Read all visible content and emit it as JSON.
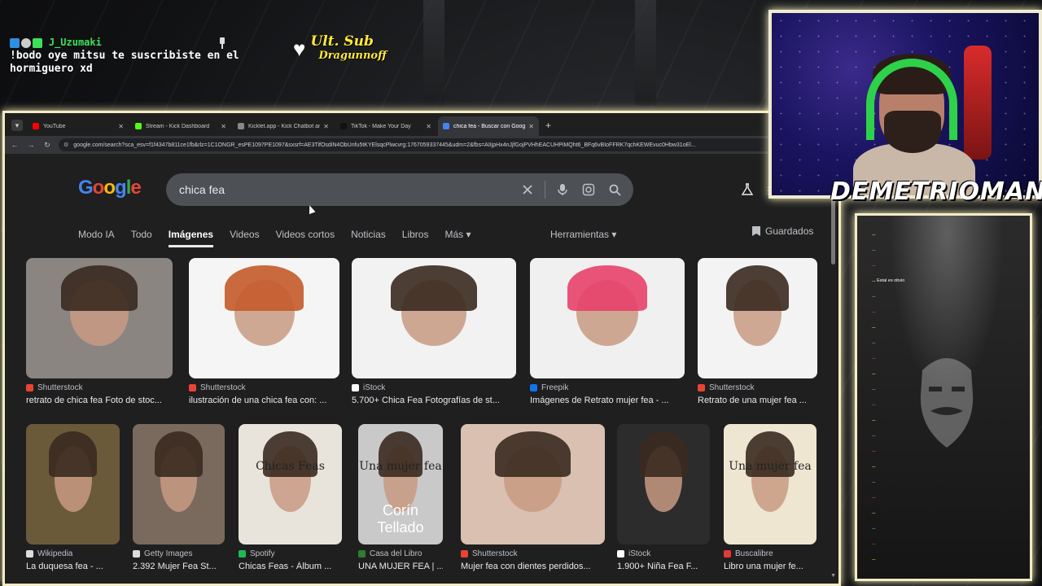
{
  "overlay": {
    "chat_alert": {
      "username": "J_Uzumaki",
      "message": "!bodo oye mitsu te suscribiste en el hormiguero xd"
    },
    "last_sub": {
      "label": "Ult. Sub",
      "name": "Dragunnoff"
    },
    "streamer_name": "DEMETRIOMAN..."
  },
  "browser": {
    "tabs": [
      {
        "title": "YouTube",
        "favicon_color": "#ff0000",
        "active": false
      },
      {
        "title": "Stream - Kick Dashboard",
        "favicon_color": "#53fc18",
        "active": false
      },
      {
        "title": "Kicklet.app - Kick Chatbot and",
        "favicon_color": "#888888",
        "active": false
      },
      {
        "title": "TikTok - Make Your Day",
        "favicon_color": "#111111",
        "active": false
      },
      {
        "title": "chica fea - Buscar con Google",
        "favicon_color": "#4285f4",
        "active": true
      }
    ],
    "url": "google.com/search?sca_esv=f1f4347b811ce1fb&rlz=1C1ONGR_esPE1097PE1097&sxsrf=AE3TifOsdiN4ObUnfu5tKYElsqcPlwcvrg:1767059337445&udm=2&fbs=AIIjpHx4nJjfGojPVHhEACUHPiMQht6_BFq6vBIoFFRK7qchKEWEvuc0Hbw31oEl..."
  },
  "google": {
    "logo": "Google",
    "query": "chica fea",
    "tabs": [
      "Modo IA",
      "Todo",
      "Imágenes",
      "Videos",
      "Videos cortos",
      "Noticias",
      "Libros",
      "Más ▾"
    ],
    "active_tab": "Imágenes",
    "tools_label": "Herramientas ▾",
    "saved_label": "Guardados",
    "results_row1": [
      {
        "source": "Shutterstock",
        "title": "retrato de chica fea Foto de stoc...",
        "source_color": "#ea4335",
        "bg": "#8a8580"
      },
      {
        "source": "Shutterstock",
        "title": "ilustración de una chica fea con: ...",
        "source_color": "#ea4335",
        "bg": "#f5f5f5"
      },
      {
        "source": "iStock",
        "title": "5.700+ Chica Fea Fotografías de st...",
        "source_color": "#ffffff",
        "bg": "#f2f2f2"
      },
      {
        "source": "Freepik",
        "title": "Imágenes de Retrato mujer fea - ...",
        "source_color": "#1273eb",
        "bg": "#f0f0f0"
      },
      {
        "source": "Shutterstock",
        "title": "Retrato de una mujer fea ...",
        "source_color": "#ea4335",
        "bg": "#f3f3f3"
      }
    ],
    "results_row2": [
      {
        "source": "Wikipedia",
        "title": "La duquesa fea - ...",
        "source_color": "#dddddd",
        "bg": "#6b5a3a"
      },
      {
        "source": "Getty Images",
        "title": "2.392 Mujer Fea St...",
        "source_color": "#dddddd",
        "bg": "#7a6a5e"
      },
      {
        "source": "Spotify",
        "title": "Chicas Feas - Álbum ...",
        "source_color": "#1db954",
        "bg": "#e8e4dc",
        "cover_text": "Chicas Feas"
      },
      {
        "source": "Casa del Libro",
        "title": "UNA MUJER FEA | ...",
        "source_color": "#2e7d32",
        "bg": "#c9c9c9",
        "cover_text": "Una mujer fea",
        "cover_author": "Corín Tellado"
      },
      {
        "source": "Shutterstock",
        "title": "Mujer fea con dientes perdidos...",
        "source_color": "#ea4335",
        "bg": "#d9c0b0"
      },
      {
        "source": "iStock",
        "title": "1.900+ Niña Fea F...",
        "source_color": "#ffffff",
        "bg": "#2c2c2c"
      },
      {
        "source": "Buscalibre",
        "title": "Libro una mujer fe...",
        "source_color": "#e53935",
        "bg": "#efe6d2",
        "cover_text": "Una mujer fea"
      }
    ]
  },
  "chat_panel": {
    "messages": [
      {
        "user": "...",
        "text": ""
      },
      {
        "user": "...",
        "text": ""
      },
      {
        "user": "...",
        "text": ""
      },
      {
        "user": "...",
        "text": "Estal es obvio"
      },
      {
        "user": "...",
        "text": ""
      },
      {
        "user": "...",
        "text": ""
      },
      {
        "user": "...",
        "text": ""
      },
      {
        "user": "...",
        "text": ""
      },
      {
        "user": "...",
        "text": ""
      },
      {
        "user": "...",
        "text": ""
      },
      {
        "user": "...",
        "text": ""
      },
      {
        "user": "...",
        "text": ""
      },
      {
        "user": "...",
        "text": ""
      },
      {
        "user": "...",
        "text": ""
      },
      {
        "user": "...",
        "text": ""
      },
      {
        "user": "...",
        "text": ""
      },
      {
        "user": "...",
        "text": ""
      },
      {
        "user": "...",
        "text": ""
      },
      {
        "user": "...",
        "text": ""
      },
      {
        "user": "...",
        "text": ""
      },
      {
        "user": "...",
        "text": ""
      },
      {
        "user": "...",
        "text": ""
      }
    ]
  }
}
